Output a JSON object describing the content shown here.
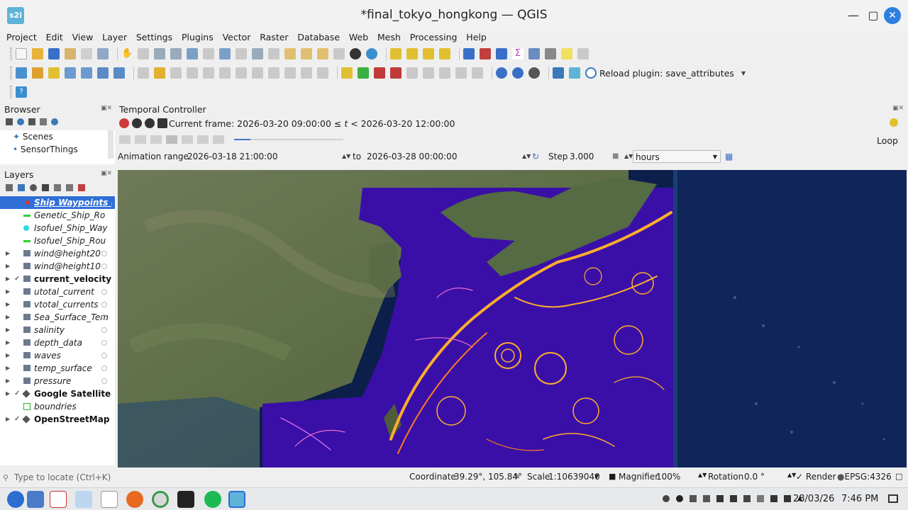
{
  "window": {
    "title": "*final_tokyo_hongkong — QGIS",
    "app_icon_text": "s2i"
  },
  "menu": [
    "Project",
    "Edit",
    "View",
    "Layer",
    "Settings",
    "Plugins",
    "Vector",
    "Raster",
    "Database",
    "Web",
    "Mesh",
    "Processing",
    "Help"
  ],
  "toolbar": {
    "plugin_label": "Reload plugin: save_attributes"
  },
  "browser": {
    "title": "Browser",
    "items": [
      "Scenes",
      "SensorThings"
    ]
  },
  "layers": {
    "title": "Layers",
    "items": [
      {
        "name": "Ship Waypoints (",
        "selected": true,
        "checked": false,
        "symbol": "point-red",
        "expandable": false
      },
      {
        "name": "Genetic_Ship_Ro",
        "checked": false,
        "symbol": "line-green",
        "expandable": false
      },
      {
        "name": "Isofuel_Ship_Way",
        "checked": false,
        "symbol": "point-cyan",
        "expandable": false
      },
      {
        "name": "Isofuel_Ship_Rou",
        "checked": false,
        "symbol": "line-green",
        "expandable": false
      },
      {
        "name": "wind@height20",
        "checked": false,
        "symbol": "raster",
        "expandable": true
      },
      {
        "name": "wind@height10",
        "checked": false,
        "symbol": "raster",
        "expandable": true
      },
      {
        "name": "current_velocity",
        "checked": true,
        "symbol": "raster",
        "expandable": true,
        "bold": true
      },
      {
        "name": "utotal_current",
        "checked": false,
        "symbol": "raster",
        "expandable": true
      },
      {
        "name": "vtotal_currents",
        "checked": false,
        "symbol": "raster",
        "expandable": true
      },
      {
        "name": "Sea_Surface_Tem",
        "checked": false,
        "symbol": "raster",
        "expandable": true
      },
      {
        "name": "salinity",
        "checked": false,
        "symbol": "raster",
        "expandable": true
      },
      {
        "name": "depth_data",
        "checked": false,
        "symbol": "raster",
        "expandable": true
      },
      {
        "name": "waves",
        "checked": false,
        "symbol": "raster",
        "expandable": true
      },
      {
        "name": "temp_surface",
        "checked": false,
        "symbol": "raster",
        "expandable": true
      },
      {
        "name": "pressure",
        "checked": false,
        "symbol": "raster",
        "expandable": true
      },
      {
        "name": "Google Satellite",
        "checked": true,
        "symbol": "xyz",
        "expandable": true,
        "bold": true
      },
      {
        "name": "boundries",
        "checked": false,
        "symbol": "polygon-green",
        "expandable": false
      },
      {
        "name": "OpenStreetMap",
        "checked": true,
        "symbol": "xyz",
        "expandable": true,
        "bold": true
      }
    ]
  },
  "temporal": {
    "title": "Temporal Controller",
    "current_frame_prefix": "Current frame: 2026-03-20 09:00:00 ≤ ",
    "current_frame_t": "t",
    "current_frame_suffix": " < 2026-03-20 12:00:00",
    "loop_label": "Loop",
    "range_label": "Animation range",
    "range_start": "2026-03-18 21:00:00",
    "to_label": "to",
    "range_end": "2026-03-28 00:00:00",
    "step_label": "Step",
    "step_value": "3.000",
    "unit": "hours",
    "slider_progress": 0.15
  },
  "status": {
    "locate_placeholder": "Type to locate (Ctrl+K)",
    "coordinate_label": "Coordinate",
    "coordinate_value": "39.29°, 105.84°",
    "scale_label": "Scale",
    "scale_value": "1:10639040",
    "magnifier_label": "Magnifier",
    "magnifier_value": "100%",
    "rotation_label": "Rotation",
    "rotation_value": "0.0 °",
    "render_label": "Render",
    "crs": "EPSG:4326"
  },
  "taskbar": {
    "date": "28/03/26",
    "time": "7:46 PM"
  },
  "colors": {
    "selection": "#2f6fd6",
    "current_purple": "#3a0fa8",
    "current_orange": "#ffae2b",
    "ocean": "#0c1f4a"
  }
}
